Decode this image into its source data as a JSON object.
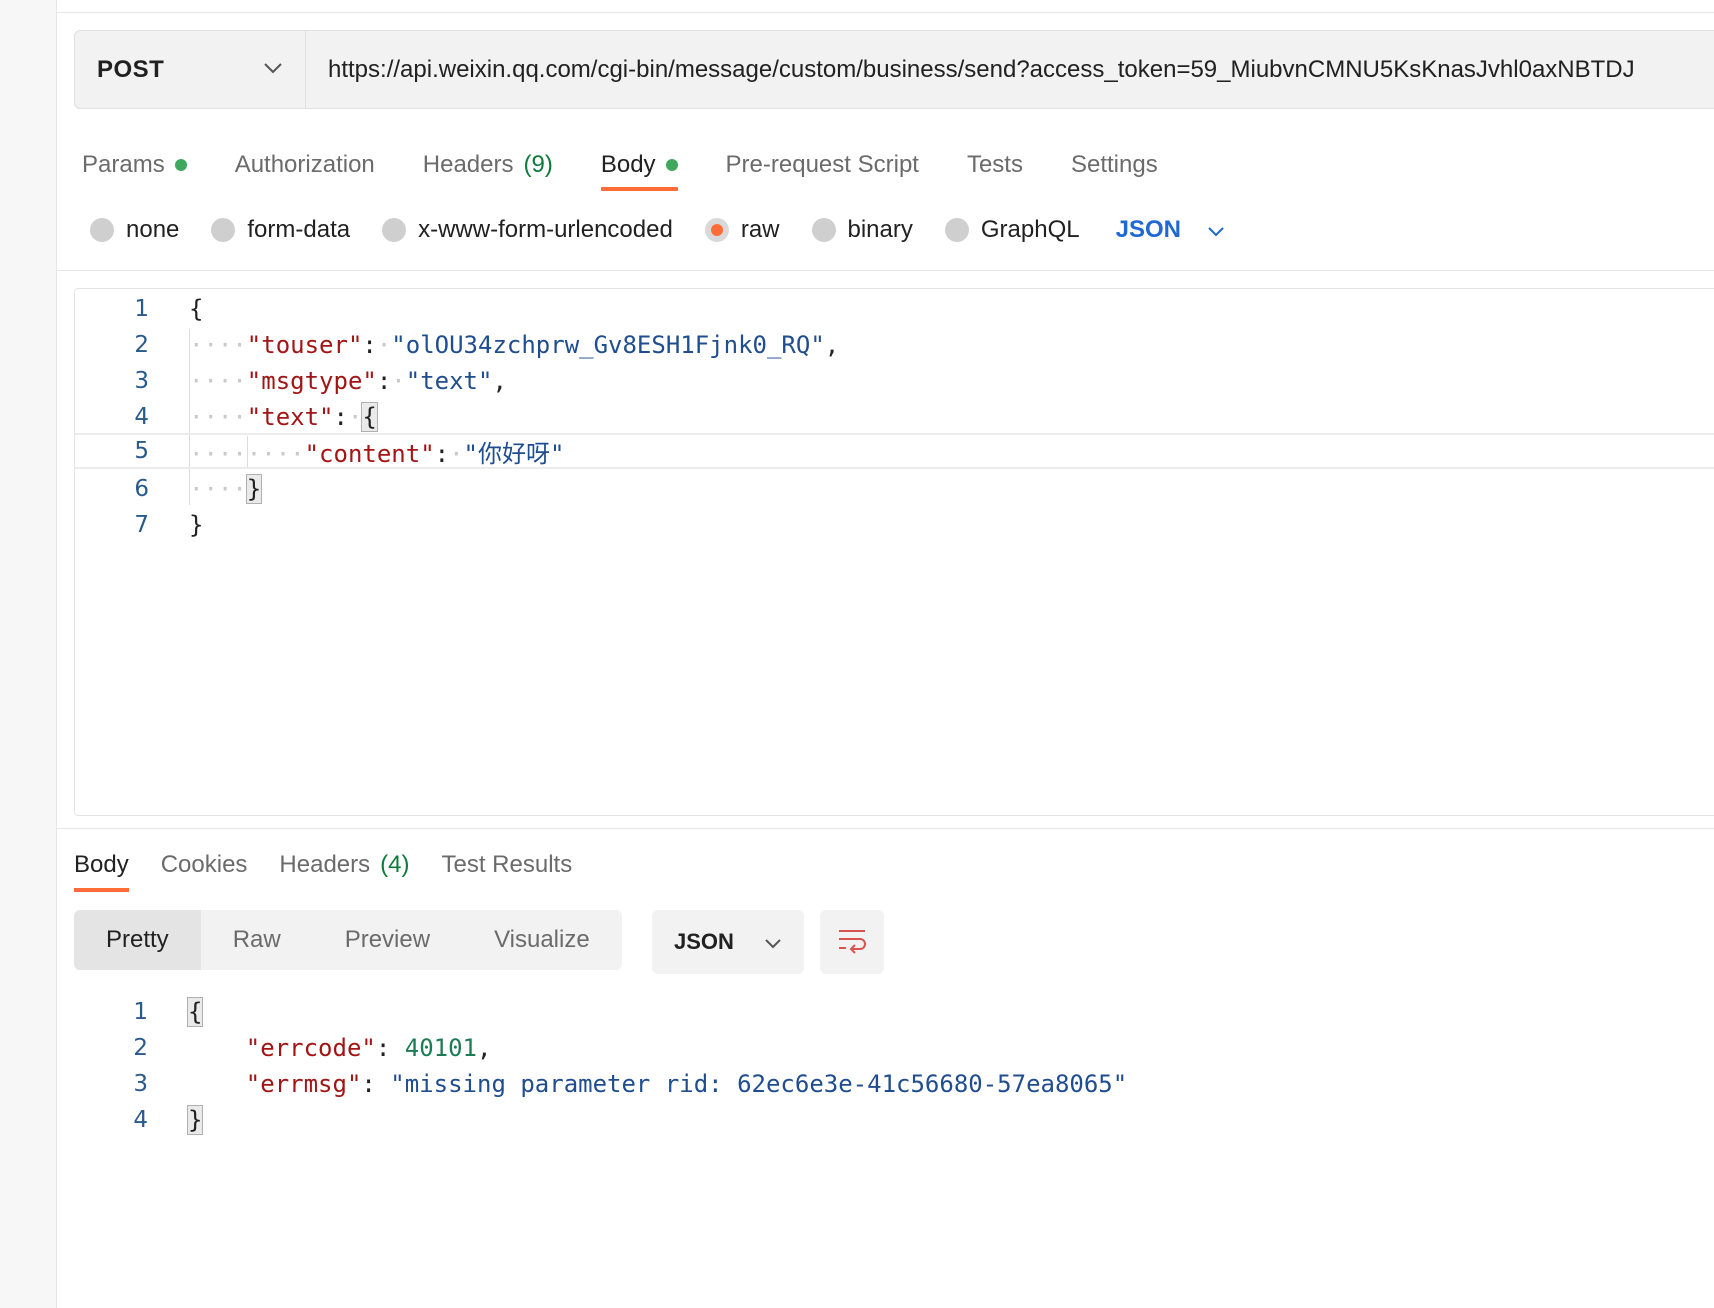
{
  "request": {
    "method": "POST",
    "url": "https://api.weixin.qq.com/cgi-bin/message/custom/business/send?access_token=59_MiubvnCMNU5KsKnasJvhl0axNBTDJ"
  },
  "request_tabs": [
    {
      "label": "Params",
      "dot": true
    },
    {
      "label": "Authorization"
    },
    {
      "label": "Headers",
      "count": "(9)"
    },
    {
      "label": "Body",
      "dot": true,
      "active": true
    },
    {
      "label": "Pre-request Script"
    },
    {
      "label": "Tests"
    },
    {
      "label": "Settings"
    }
  ],
  "body_types": {
    "options": [
      "none",
      "form-data",
      "x-www-form-urlencoded",
      "raw",
      "binary",
      "GraphQL"
    ],
    "selected": "raw",
    "language": "JSON"
  },
  "request_body": {
    "line_numbers": [
      "1",
      "2",
      "3",
      "4",
      "5",
      "6",
      "7"
    ],
    "touser_key": "\"touser\"",
    "touser_value": "\"olOU34zchprw_Gv8ESH1Fjnk0_RQ\"",
    "msgtype_key": "\"msgtype\"",
    "msgtype_value": "\"text\"",
    "text_key": "\"text\"",
    "content_key": "\"content\"",
    "content_value": "\"你好呀\""
  },
  "response_tabs": [
    {
      "label": "Body",
      "active": true
    },
    {
      "label": "Cookies"
    },
    {
      "label": "Headers",
      "count": "(4)"
    },
    {
      "label": "Test Results"
    }
  ],
  "response_view": {
    "modes": [
      "Pretty",
      "Raw",
      "Preview",
      "Visualize"
    ],
    "active_mode": "Pretty",
    "language": "JSON"
  },
  "response_body": {
    "line_numbers": [
      "1",
      "2",
      "3",
      "4"
    ],
    "errcode_key": "\"errcode\"",
    "errcode_value": "40101",
    "errmsg_key": "\"errmsg\"",
    "errmsg_value": "\"missing parameter rid: 62ec6e3e-41c56680-57ea8065\""
  },
  "colors": {
    "accent": "#ff6c37",
    "success_dot": "#3fa85d",
    "link_blue": "#1f6ad2",
    "json_key": "#a31515",
    "json_string": "#1f4d8f",
    "json_number": "#1c7c54"
  },
  "icons": [
    "chevron-down-icon",
    "wrap-lines-icon"
  ]
}
